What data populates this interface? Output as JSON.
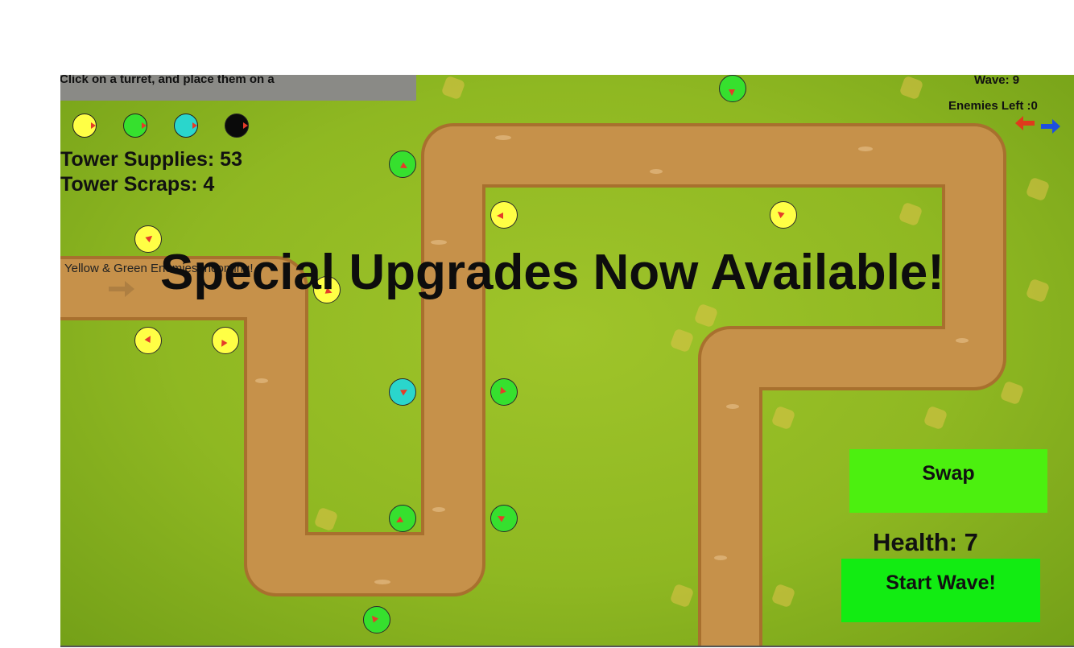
{
  "hud": {
    "instruction": "Click on a turret, and place them on a",
    "wave": "Wave: 9",
    "enemies_left": "Enemies Left :0",
    "tower_supplies": "Tower Supplies: 53",
    "tower_scraps": "Tower Scraps: 4",
    "health": "Health: 7"
  },
  "palette": [
    {
      "name": "yellow-turret",
      "color": "#ffff45"
    },
    {
      "name": "green-turret",
      "color": "#36e02e"
    },
    {
      "name": "cyan-turret",
      "color": "#2ad6cc"
    },
    {
      "name": "black-turret",
      "color": "#0a0a0a"
    }
  ],
  "banner": "Special Upgrades Now Available!",
  "incoming": "Yellow & Green Enemies Incoming!",
  "buttons": {
    "swap": "Swap",
    "start_wave": "Start Wave!"
  },
  "colors": {
    "grass": "#8fb822",
    "path": "#c6914a",
    "path_edge": "#a8702e",
    "swap_button": "#4cf00f",
    "start_button": "#12ec12",
    "barrel": "#e43c2a",
    "left_arrow": "#e03a1c",
    "right_arrow": "#1e4fe0"
  },
  "icons": {
    "left_arrow": "arrow-left-icon",
    "right_arrow": "arrow-right-icon",
    "path_arrow": "arrow-right-icon"
  }
}
